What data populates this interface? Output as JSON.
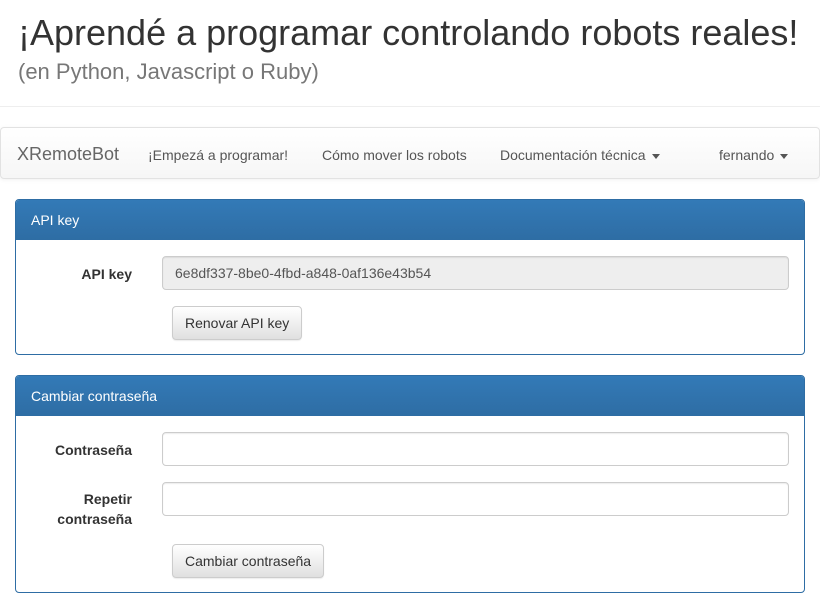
{
  "header": {
    "title": "¡Aprendé a programar controlando robots reales!",
    "subtitle": "(en Python, Javascript o Ruby)"
  },
  "navbar": {
    "brand": "XRemoteBot",
    "items": [
      {
        "label": "¡Empezá a programar!"
      },
      {
        "label": "Cómo mover los robots"
      },
      {
        "label": "Documentación técnica",
        "dropdown": true
      }
    ],
    "user": {
      "label": "fernando",
      "dropdown": true
    }
  },
  "api_panel": {
    "heading": "API key",
    "label": "API key",
    "value": "6e8df337-8be0-4fbd-a848-0af136e43b54",
    "button": "Renovar API key"
  },
  "password_panel": {
    "heading": "Cambiar contraseña",
    "password_label": "Contraseña",
    "password_value": "",
    "repeat_label_line1": "Repetir",
    "repeat_label_line2": "contraseña",
    "repeat_value": "",
    "button": "Cambiar contraseña"
  },
  "colors": {
    "panel_primary": "#337ab7",
    "panel_border": "#2e6da4",
    "readonly_bg": "#eeeeee"
  }
}
